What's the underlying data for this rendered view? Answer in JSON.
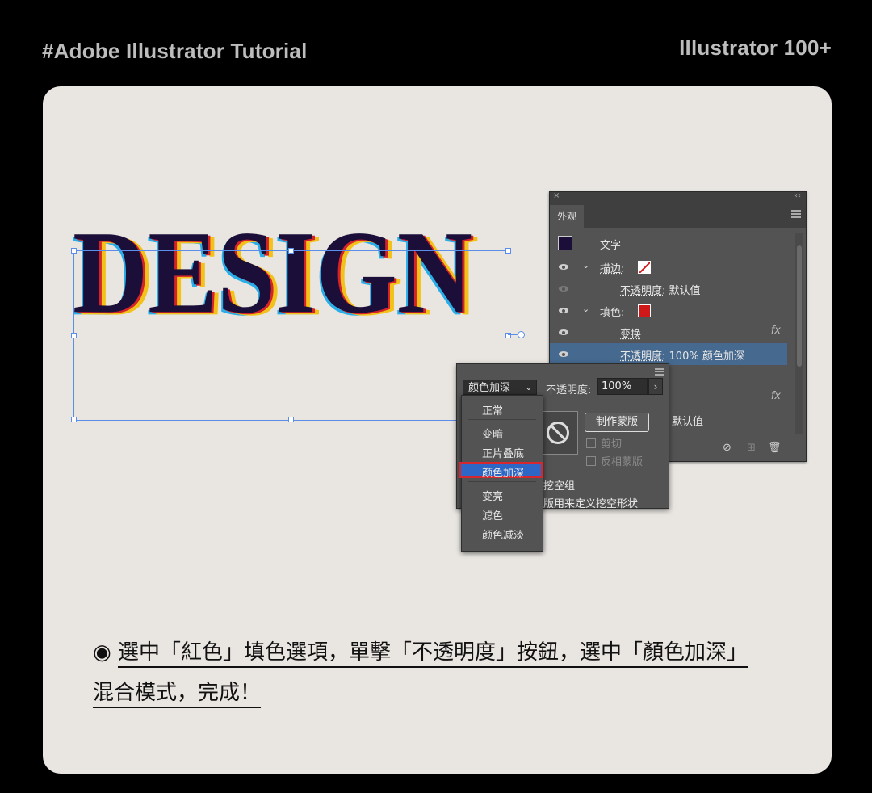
{
  "header": {
    "left_title": "#Adobe Illustrator Tutorial",
    "right_title": "Illustrator 100+"
  },
  "artwork": {
    "word": "DESIGN"
  },
  "appearance_panel": {
    "close": "×",
    "collapse": "‹‹",
    "tab": "外观",
    "rows": [
      {
        "label": "文字"
      },
      {
        "label": "描边:"
      },
      {
        "label": "不透明度:",
        "value": "默认值"
      },
      {
        "label": "填色:"
      },
      {
        "label": "变换"
      },
      {
        "label": "不透明度:",
        "value": "100% 颜色加深"
      },
      {
        "label": ""
      },
      {
        "label": ""
      },
      {
        "label": "默认值"
      }
    ],
    "fx": "fx"
  },
  "transparency": {
    "blend_mode": "颜色加深",
    "opacity_label": "不透明度:",
    "opacity_value": "100%",
    "make_mask": "制作蒙版",
    "clip": "剪切",
    "invert_mask": "反相蒙版",
    "knockout_text": "挖空组",
    "knockout_shape_text": "蒙版用来定义挖空形状"
  },
  "blend_menu": {
    "items": [
      "正常",
      "变暗",
      "正片叠底",
      "颜色加深",
      "变亮",
      "滤色",
      "颜色减淡"
    ],
    "selected": "颜色加深"
  },
  "caption": {
    "bullet": "◉",
    "line1": "選中「紅色」填色選項，單擊「不透明度」按鈕，選中「顏色加深」",
    "line2": "混合模式，完成！"
  },
  "colors": {
    "background": "#000000",
    "card": "#e9e6e2",
    "panel": "#535353",
    "selection_blue": "#2d66c4",
    "highlight_red": "#d6262e"
  }
}
